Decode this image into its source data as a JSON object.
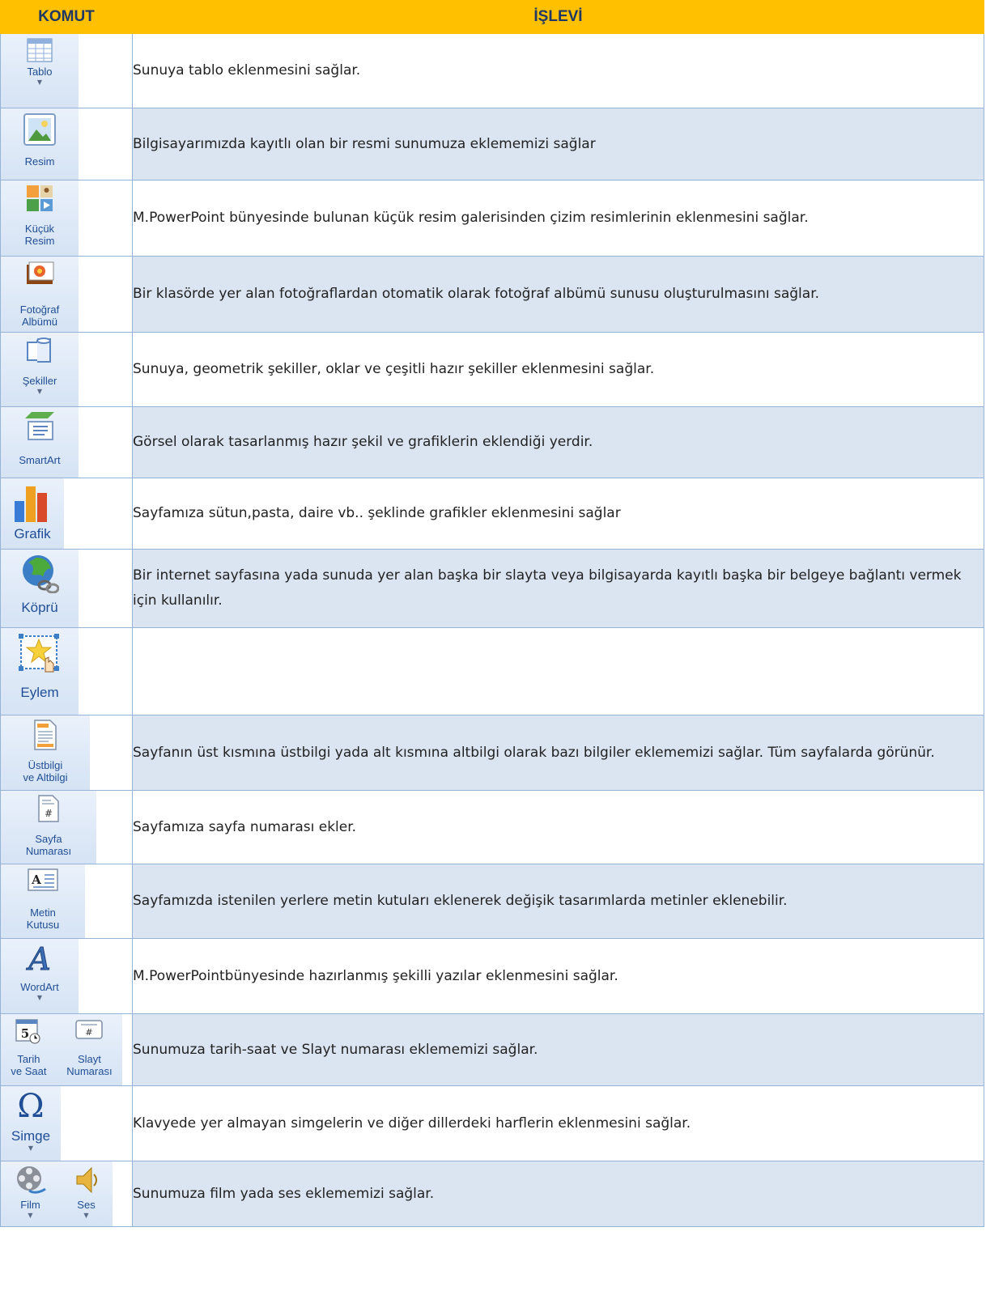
{
  "header": {
    "komut": "KOMUT",
    "islevi": "İŞLEVİ"
  },
  "rows": [
    {
      "labels": [
        "Tablo"
      ],
      "desc": "Sunuya tablo eklenmesini sağlar."
    },
    {
      "labels": [
        "Resim"
      ],
      "desc": "Bilgisayarımızda kayıtlı olan bir resmi sunumuza  eklememizi sağlar"
    },
    {
      "labels": [
        "Küçük\nResim"
      ],
      "desc": "M.PowerPoint bünyesinde bulunan küçük resim galerisinden çizim resimlerinin eklenmesini sağlar."
    },
    {
      "labels": [
        "Fotoğraf\nAlbümü"
      ],
      "desc": "Bir klasörde yer alan fotoğraflardan otomatik olarak fotoğraf albümü sunusu oluşturulmasını sağlar."
    },
    {
      "labels": [
        "Şekiller"
      ],
      "desc": "Sunuya, geometrik şekiller, oklar ve çeşitli hazır şekiller eklenmesini sağlar."
    },
    {
      "labels": [
        "SmartArt"
      ],
      "desc": "Görsel olarak tasarlanmış hazır şekil ve grafiklerin eklendiği yerdir."
    },
    {
      "labels": [
        "Grafik"
      ],
      "desc": "Sayfamıza sütun,pasta, daire vb.. şeklinde grafikler eklenmesini sağlar"
    },
    {
      "labels": [
        "Köprü"
      ],
      "desc": "Bir internet sayfasına yada sunuda yer alan başka bir slayta veya bilgisayarda kayıtlı başka bir belgeye bağlantı vermek için kullanılır."
    },
    {
      "labels": [
        "Eylem"
      ],
      "desc": ""
    },
    {
      "labels": [
        "Üstbilgi\nve Altbilgi"
      ],
      "desc": "Sayfanın üst kısmına üstbilgi yada alt kısmına altbilgi olarak bazı bilgiler eklememizi sağlar. Tüm sayfalarda görünür."
    },
    {
      "labels": [
        "Sayfa\nNumarası"
      ],
      "desc": "Sayfamıza sayfa numarası ekler."
    },
    {
      "labels": [
        "Metin\nKutusu"
      ],
      "desc": "Sayfamızda istenilen yerlere metin kutuları eklenerek değişik tasarımlarda metinler eklenebilir."
    },
    {
      "labels": [
        "WordArt"
      ],
      "desc": "M.PowerPointbünyesinde hazırlanmış şekilli yazılar eklenmesini sağlar."
    },
    {
      "labels": [
        "Tarih\nve Saat",
        "Slayt\nNumarası"
      ],
      "desc": "Sunumuza tarih-saat ve Slayt numarası eklememizi sağlar."
    },
    {
      "labels": [
        "Simge"
      ],
      "desc": "Klavyede yer almayan simgelerin ve diğer dillerdeki harflerin eklenmesini sağlar."
    },
    {
      "labels": [
        "Film",
        "Ses"
      ],
      "desc": "Sunumuza film yada ses eklememizi sağlar."
    }
  ]
}
